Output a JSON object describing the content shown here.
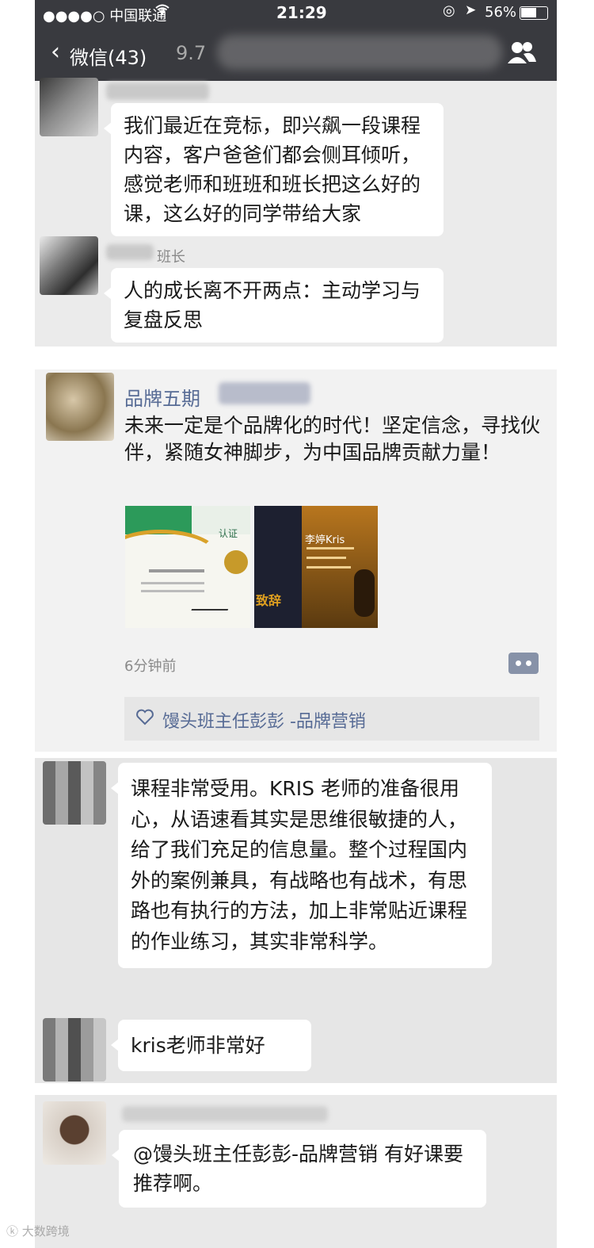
{
  "status_bar": {
    "carrier": "●●●●○ 中国联通",
    "time": "21:29",
    "battery": "56%"
  },
  "nav": {
    "back_label": "微信(43)",
    "title": "9.7"
  },
  "chat1": [
    {
      "sender": "",
      "text": "我们最近在竞标，即兴飙一段课程内容，客户爸爸们都会侧耳倾听，感觉老师和班班和班长把这么好的课，这么好的同学带给大家"
    },
    {
      "sender": "班长",
      "text": "人的成长离不开两点：主动学习与复盘反思"
    }
  ],
  "moment": {
    "author": "品牌五期",
    "text": "未来一定是个品牌化的时代！坚定信念，寻找伙伴，紧随女神脚步，为中国品牌贡献力量！",
    "time": "6分钟前",
    "likes": "馒头班主任彭彭 -品牌营销",
    "image_left_caption": "认证",
    "image_right_name": "李婷Kris",
    "image_right_word": "致辞"
  },
  "chat2": [
    {
      "text": "课程非常受用。KRIS 老师的准备很用心，从语速看其实是思维很敏捷的人，给了我们充足的信息量。整个过程国内外的案例兼具，有战略也有战术，有思路也有执行的方法，加上非常贴近课程的作业练习，其实非常科学。"
    },
    {
      "text": "kris老师非常好"
    }
  ],
  "chat3": {
    "text": "@馒头班主任彭彭-品牌营销 有好课要推荐啊。"
  },
  "watermark": "大数跨境",
  "colors": {
    "nav_bg": "#393a3f",
    "link_blue": "#576b95"
  }
}
